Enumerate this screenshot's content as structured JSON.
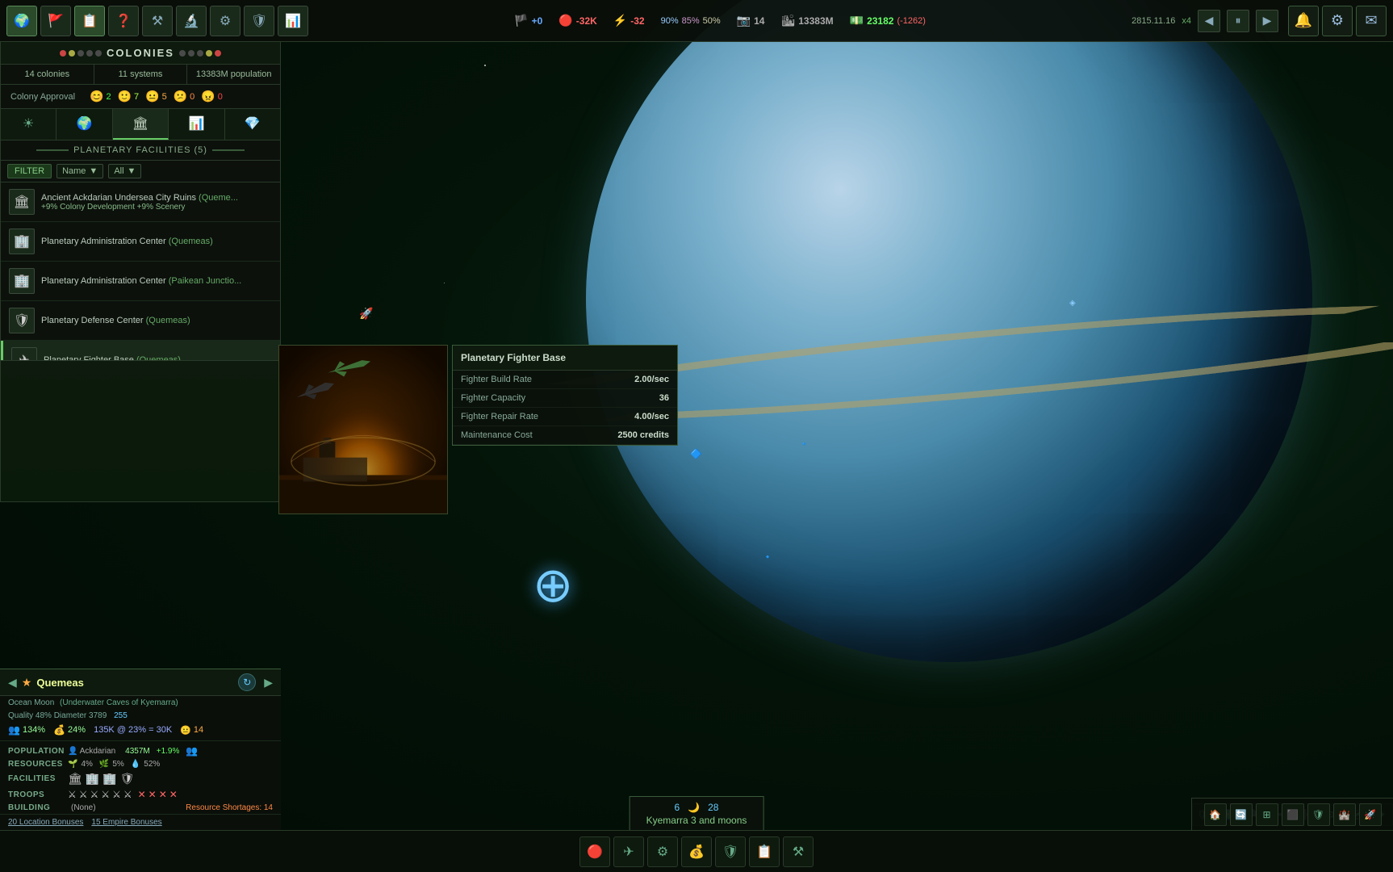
{
  "game": {
    "date": "2815.11.16",
    "speed": "x4"
  },
  "top_bar": {
    "icons": [
      "🌍",
      "🚩",
      "📋",
      "❓",
      "⚒",
      "🔬",
      "⚙",
      "🛡",
      "📊"
    ],
    "stats": {
      "credits_icon": "💰",
      "credits_val": "+0",
      "red_icon": "🔴",
      "red_val": "-32K",
      "yellow_icon": "⚡",
      "yellow_val": "-32",
      "shield_val": "90%",
      "bar_val": "85%",
      "bullet_val": "50%",
      "camera_icon": "📷",
      "camera_val": "14",
      "population_val": "13383M",
      "credits_total": "23182",
      "credits_change": "(-1262)"
    },
    "nav": {
      "prev": "◀",
      "pause": "⏸",
      "next": "▶"
    },
    "right_icons": [
      "🔔",
      "⚙",
      "✉"
    ]
  },
  "colony_panel": {
    "title": "COLONIES",
    "dots_left": [
      "red",
      "yellow",
      "green",
      "gray",
      "gray"
    ],
    "dots_right": [
      "gray",
      "gray",
      "gray",
      "yellow",
      "red"
    ],
    "tabs": {
      "colonies": "14 colonies",
      "systems": "11 systems",
      "population": "13383M population"
    },
    "approval": {
      "label": "Colony Approval",
      "items": [
        {
          "face": "😊",
          "count": "2",
          "color": "face-green"
        },
        {
          "face": "🙂",
          "count": "7",
          "color": "face-lime"
        },
        {
          "face": "😐",
          "count": "5",
          "color": "face-yellow"
        },
        {
          "face": "😕",
          "count": "0",
          "color": "face-orange"
        },
        {
          "face": "😠",
          "count": "0",
          "color": "face-red"
        }
      ]
    },
    "view_tabs": [
      "☀",
      "🌍",
      "🏛",
      "📊",
      "💎"
    ],
    "active_tab_index": 2,
    "facilities_header": "PLANETARY FACILITIES (5)",
    "filter": {
      "label": "FILTER",
      "name_label": "Name",
      "all_label": "All"
    },
    "facilities": [
      {
        "name": "Ancient Ackdarian Undersea City Ruins",
        "location": "(Queme...",
        "bonus": "+9% Colony Development  +9% Scenery",
        "icon": "🏛"
      },
      {
        "name": "Planetary Administration Center",
        "location": "(Quemeas)",
        "bonus": "",
        "icon": "🏢"
      },
      {
        "name": "Planetary Administration Center",
        "location": "(Paikean Junctio...",
        "bonus": "",
        "icon": "🏢"
      },
      {
        "name": "Planetary Defense Center",
        "location": "(Quemeas)",
        "bonus": "",
        "icon": "🛡"
      },
      {
        "name": "Planetary Fighter Base",
        "location": "(Quemeas)",
        "bonus": "",
        "icon": "✈",
        "selected": true
      }
    ]
  },
  "facility_tooltip": {
    "title": "Planetary Fighter Base",
    "stats": [
      {
        "label": "Fighter Build Rate",
        "value": "2.00/sec"
      },
      {
        "label": "Fighter Capacity",
        "value": "36"
      },
      {
        "label": "Fighter Repair Rate",
        "value": "4.00/sec"
      },
      {
        "label": "Maintenance Cost",
        "value": "2500 credits"
      }
    ]
  },
  "colony_info": {
    "name": "Quemeas",
    "type": "Ocean Moon",
    "subtitle": "(Underwater Caves of Kyemarra)",
    "quality": "48%",
    "diameter": "3789",
    "defense": "255",
    "stats": {
      "population_icon": "👥",
      "pop_val": "134%",
      "money_icon": "💰",
      "money_val": "24%",
      "income": "135K @ 23% = 30K",
      "approval": "14",
      "population_label": "POPULATION",
      "race": "Ackdarian",
      "pop_count": "4357M",
      "growth": "+1.9%",
      "resources_label": "RESOURCES",
      "res1": "4%",
      "res2": "5%",
      "res3": "52%",
      "facilities_label": "FACILITIES",
      "troops_label": "TROOPS",
      "building_label": "BUILDING",
      "building_val": "(None)",
      "shortages": "Resource Shortages: 14"
    },
    "bonuses": {
      "location": "20 Location Bonuses",
      "empire": "15 Empire Bonuses"
    }
  },
  "bottom_tooltip": {
    "planet_name": "Kyemarra 3 and moons",
    "num1": "6",
    "num2": "28"
  },
  "bottom_bar": {
    "icons": [
      "🔴",
      "✈",
      "⚙",
      "💰",
      "🛡",
      "📋",
      "⚒"
    ]
  }
}
